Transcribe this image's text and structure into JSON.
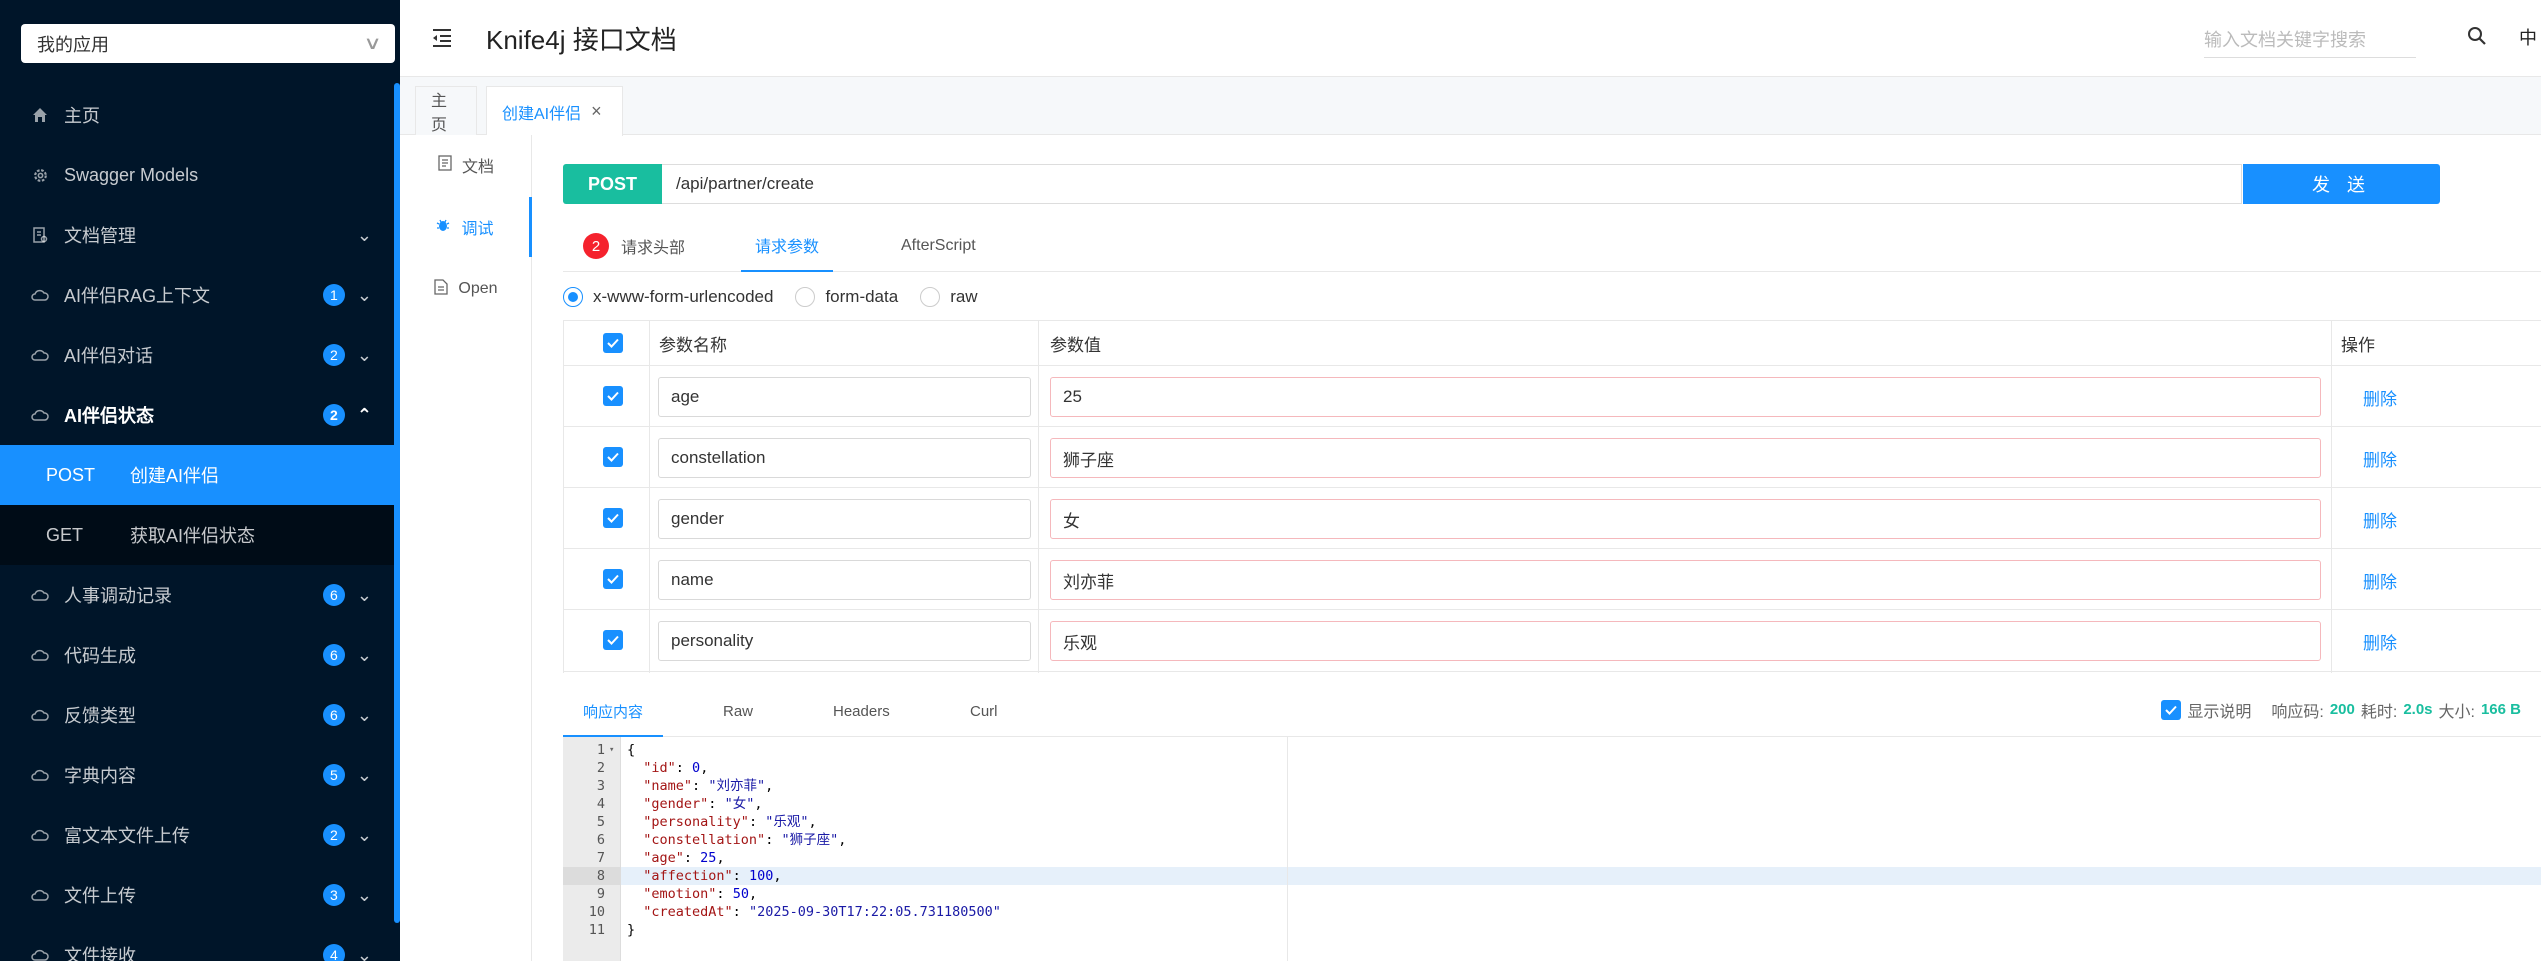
{
  "app_selector": {
    "value": "我的应用"
  },
  "header": {
    "title": "Knife4j 接口文档",
    "search_placeholder": "输入文档关键字搜索",
    "lang": "中"
  },
  "sidebar": {
    "items": [
      {
        "label": "主页",
        "icon": "home-icon"
      },
      {
        "label": "Swagger Models",
        "icon": "gear-icon"
      },
      {
        "label": "文档管理",
        "icon": "doc-manage-icon"
      },
      {
        "label": "AI伴侣RAG上下文",
        "badge": "1",
        "icon": "cloud-icon"
      },
      {
        "label": "AI伴侣对话",
        "badge": "2",
        "icon": "cloud-icon"
      },
      {
        "label": "AI伴侣状态",
        "badge": "2",
        "icon": "cloud-icon",
        "open": true,
        "children": [
          {
            "method": "POST",
            "label": "创建AI伴侣",
            "active": true
          },
          {
            "method": "GET",
            "label": "获取AI伴侣状态"
          }
        ]
      },
      {
        "label": "人事调动记录",
        "badge": "6",
        "icon": "cloud-icon"
      },
      {
        "label": "代码生成",
        "badge": "6",
        "icon": "cloud-icon"
      },
      {
        "label": "反馈类型",
        "badge": "6",
        "icon": "cloud-icon"
      },
      {
        "label": "字典内容",
        "badge": "5",
        "icon": "cloud-icon"
      },
      {
        "label": "富文本文件上传",
        "badge": "2",
        "icon": "cloud-icon"
      },
      {
        "label": "文件上传",
        "badge": "3",
        "icon": "cloud-icon"
      },
      {
        "label": "文件接收",
        "badge": "4",
        "icon": "cloud-icon"
      }
    ]
  },
  "page_tabs": [
    {
      "label": "主页"
    },
    {
      "label": "创建AI伴侣"
    }
  ],
  "subnav": [
    {
      "label": "文档"
    },
    {
      "label": "调试"
    },
    {
      "label": "Open"
    }
  ],
  "request": {
    "method": "POST",
    "url": "/api/partner/create",
    "send_label": "发 送"
  },
  "request_tabs": {
    "headers_badge": "2",
    "headers": "请求头部",
    "params": "请求参数",
    "after": "AfterScript"
  },
  "content_types": [
    "x-www-form-urlencoded",
    "form-data",
    "raw"
  ],
  "params_table": {
    "headers": {
      "name": "参数名称",
      "value": "参数值",
      "action": "操作"
    },
    "rows": [
      {
        "name": "age",
        "value": "25",
        "action": "删除"
      },
      {
        "name": "constellation",
        "value": "狮子座",
        "action": "删除"
      },
      {
        "name": "gender",
        "value": "女",
        "action": "删除"
      },
      {
        "name": "name",
        "value": "刘亦菲",
        "action": "删除"
      },
      {
        "name": "personality",
        "value": "乐观",
        "action": "删除"
      }
    ]
  },
  "response_tabs": {
    "content": "响应内容",
    "raw": "Raw",
    "headers": "Headers",
    "curl": "Curl"
  },
  "response_info": {
    "show_desc": "显示说明",
    "code_label": "响应码:",
    "code": "200",
    "time_label": "耗时:",
    "time": "2.0s",
    "size_label": "大小:",
    "size": "166 B"
  },
  "response_lines": [
    "1",
    "2",
    "3",
    "4",
    "5",
    "6",
    "7",
    "8",
    "9",
    "10",
    "11"
  ],
  "colors": {
    "sidebar_bg": "#001529",
    "accent": "#1890ff",
    "post": "#19be9f",
    "badge_red": "#f5222d"
  }
}
